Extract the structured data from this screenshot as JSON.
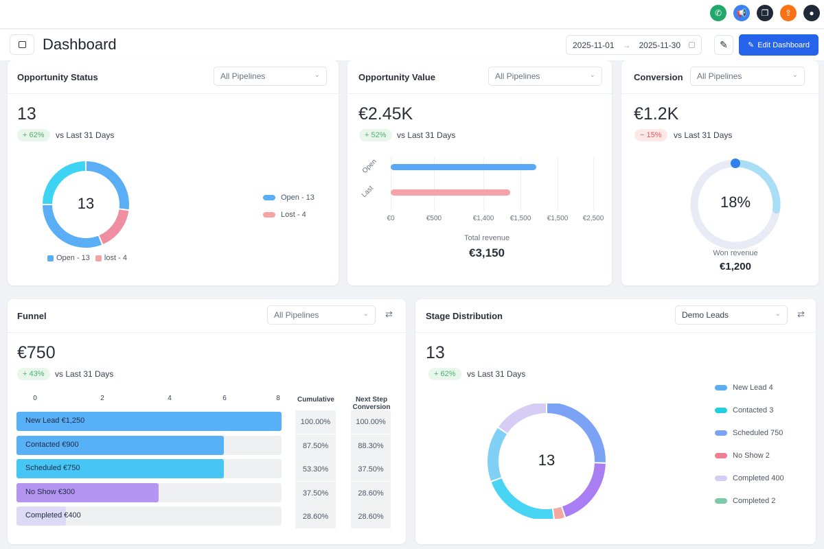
{
  "topbar": {
    "icons": [
      {
        "name": "phone-icon",
        "color": "#22a86b",
        "glyph": "✆"
      },
      {
        "name": "megaphone-icon",
        "color": "#3b82f6",
        "glyph": "📢"
      },
      {
        "name": "copy-icon",
        "color": "#1f2937",
        "glyph": "❐"
      },
      {
        "name": "upload-icon",
        "color": "#f97316",
        "glyph": "⇪"
      },
      {
        "name": "user-icon",
        "color": "#1f2937",
        "glyph": "●"
      }
    ]
  },
  "header": {
    "title": "Dashboard",
    "date_start": "2025-11-01",
    "date_arrow": "→",
    "date_end": "2025-11-30",
    "edit_label": "Edit Dashboard",
    "accent": "#2563eb"
  },
  "opportunity_status": {
    "title": "Opportunity Status",
    "select": "All Pipelines",
    "value": "13",
    "change": "+ 62%",
    "vs": "vs Last 31 Days",
    "center": "13",
    "legend_right": [
      {
        "label": "Open - 13",
        "color": "#5aaef5"
      },
      {
        "label": "Lost - 4",
        "color": "#f5a3a3"
      }
    ],
    "legend_bottom": [
      {
        "label": "Open - 13",
        "color": "#5aaef5"
      },
      {
        "label": "lost - 4",
        "color": "#f5a3a3"
      }
    ],
    "segments": [
      {
        "value": 13,
        "color": "#5aaef5"
      },
      {
        "value": 8,
        "color": "#ef8ea0"
      },
      {
        "value": 15,
        "color": "#5aaef5"
      },
      {
        "value": 12,
        "color": "#3dd3f2"
      }
    ]
  },
  "opportunity_value": {
    "title": "Opportunity Value",
    "select": "All Pipelines",
    "value": "€2.45K",
    "change": "+ 52%",
    "vs": "vs Last 31 Days",
    "chart_data": {
      "type": "bar",
      "categories": [
        "Open",
        "Last"
      ],
      "values_fraction_of_axis": [
        0.72,
        0.59
      ],
      "colors": [
        "#58a8f5",
        "#f5a3a8"
      ],
      "xticks": [
        "€0",
        "€500",
        "€1,400",
        "€1,500",
        "€1,500",
        "€2,500"
      ]
    },
    "total_label": "Total revenue",
    "total": "€3,150"
  },
  "conversion": {
    "title": "Conversion",
    "select": "All Pipelines",
    "value": "€1.2K",
    "change": "− 15%",
    "vs": "vs Last 31 Days",
    "percent_label": "18%",
    "percent": 18,
    "won_label": "Won revenue",
    "won": "€1,200"
  },
  "funnel": {
    "title": "Funnel",
    "select": "All Pipelines",
    "value": "€750",
    "change": "+ 43%",
    "vs": "vs Last  31 Days",
    "chart_data": {
      "type": "bar",
      "xticks": [
        "0",
        "2",
        "4",
        "6",
        "8"
      ],
      "xlim": [
        0,
        8
      ],
      "rows": [
        {
          "label": "New Lead  €1,250",
          "value": 8,
          "color": "#58b0f7",
          "cumulative": "100.00%",
          "next": "100.00%"
        },
        {
          "label": "Contacted  €900",
          "value": 6.25,
          "color": "#58b0f7",
          "cumulative": "87.50%",
          "next": "88.30%"
        },
        {
          "label": "Scheduled  €750",
          "value": 6.25,
          "color": "#45c6f5",
          "cumulative": "53.30%",
          "next": "37.50%"
        },
        {
          "label": "No Show  €300",
          "value": 4.28,
          "color": "#b495f2",
          "cumulative": "37.50%",
          "next": "28.60%"
        },
        {
          "label": "Completed  €400",
          "value": 1.5,
          "color": "#dcdaf5",
          "cumulative": "28.60%",
          "next": "28.60%"
        }
      ]
    },
    "col_cumulative": "Cumulative",
    "col_next": "Next Step Conversion"
  },
  "stage": {
    "title": "Stage Distribution",
    "select": "Demo Leads",
    "value": "13",
    "change": "+ 62%",
    "vs": "vs Last 31 Days",
    "center": "13",
    "legend": [
      {
        "label": "New Lead  4",
        "color": "#5aaef5"
      },
      {
        "label": "Contacted  3",
        "color": "#22cfe0"
      },
      {
        "label": "Scheduled  750",
        "color": "#7ba2f5"
      },
      {
        "label": "No Show  2",
        "color": "#ef7f95"
      },
      {
        "label": "Completed  400",
        "color": "#d6cdf5"
      },
      {
        "label": "Completed  2",
        "color": "#7ccaa8"
      }
    ],
    "segments": [
      {
        "value": 25,
        "color": "#7ba2f5"
      },
      {
        "value": 19,
        "color": "#a97ef2"
      },
      {
        "value": 3,
        "color": "#f5a8a0"
      },
      {
        "value": 21,
        "color": "#47d4f5"
      },
      {
        "value": 15,
        "color": "#80d0f5"
      },
      {
        "value": 15,
        "color": "#d6cdf5"
      }
    ]
  }
}
